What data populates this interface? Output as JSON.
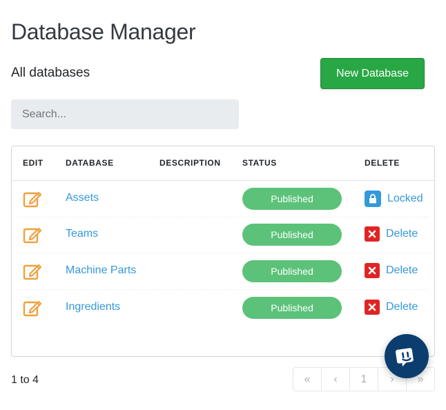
{
  "page": {
    "title": "Database Manager",
    "subtitle": "All databases"
  },
  "toolbar": {
    "new_database_label": "New Database"
  },
  "search": {
    "placeholder": "Search...",
    "value": ""
  },
  "table": {
    "columns": [
      "EDIT",
      "DATABASE",
      "DESCRIPTION",
      "STATUS",
      "DELETE"
    ],
    "rows": [
      {
        "name": "Assets",
        "description": "",
        "status": "Published",
        "delete_label": "Locked",
        "delete_icon": "lock-icon"
      },
      {
        "name": "Teams",
        "description": "",
        "status": "Published",
        "delete_label": "Delete",
        "delete_icon": "close-icon"
      },
      {
        "name": "Machine Parts",
        "description": "",
        "status": "Published",
        "delete_label": "Delete",
        "delete_icon": "close-icon"
      },
      {
        "name": "Ingredients",
        "description": "",
        "status": "Published",
        "delete_label": "Delete",
        "delete_icon": "close-icon"
      }
    ]
  },
  "footer": {
    "count_text": "1 to 4",
    "pagination": [
      "«",
      "‹",
      "1",
      "›",
      "»"
    ]
  },
  "colors": {
    "accent_link": "#3498db",
    "new_button": "#28a745",
    "status_published": "#5cc27a",
    "delete_red": "#e02424",
    "edit_orange": "#f0a03c",
    "chat_widget": "#0b3d6e"
  },
  "icons": {
    "edit": "edit-icon",
    "locked": "lock-icon",
    "delete": "close-icon",
    "chat": "chat-help-icon"
  }
}
